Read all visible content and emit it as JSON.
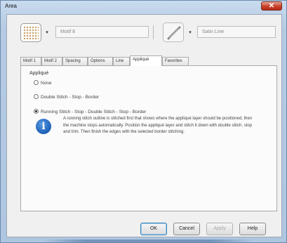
{
  "window": {
    "title": "Area",
    "close_glyph": "✕"
  },
  "toolbar": {
    "motif_value": "Motif 8",
    "needle_value": "Satin Line",
    "dropdown_glyph": "▾"
  },
  "tabs": [
    {
      "label": "Motif 1",
      "active": false
    },
    {
      "label": "Motif 2",
      "active": false
    },
    {
      "label": "Spacing",
      "active": false
    },
    {
      "label": "Options",
      "active": false
    },
    {
      "label": "Line",
      "active": false
    },
    {
      "label": "Appliqué",
      "active": true
    },
    {
      "label": "Favorites",
      "active": false
    }
  ],
  "applique": {
    "group_label": "Appliqué",
    "options": [
      {
        "label": "None",
        "selected": false
      },
      {
        "label": "Double Stitch - Stop - Border",
        "selected": false
      },
      {
        "label": "Running Stitch - Stop - Double Stitch - Stop - Border",
        "selected": true
      }
    ],
    "info_glyph": "i",
    "info_text": "A running stitch outline is stitched first that shows where the appliqué layer should be positioned, then the machine stops automatically. Position the appliqué layer and stitch it down with double stitch, stop and trim. Then finish the edges with the selected border stitching."
  },
  "buttons": {
    "ok": "OK",
    "cancel": "Cancel",
    "apply": "Apply",
    "help": "Help"
  },
  "colors": {
    "title_bar": "#c9dbee",
    "close_button": "#c8402a",
    "info_icon": "#1c5fb5"
  }
}
